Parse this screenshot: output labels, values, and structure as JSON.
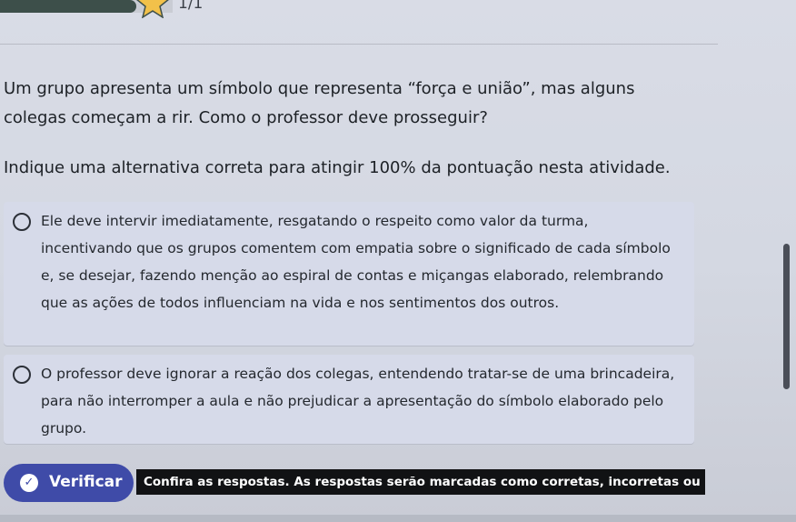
{
  "header": {
    "counter": "1/1"
  },
  "question": {
    "text": "Um grupo apresenta um símbolo que representa “força e união”, mas alguns colegas começam a rir. Como o professor deve prosseguir?",
    "instruction": "Indique uma alternativa correta para atingir 100% da pontuação nesta atividade."
  },
  "options": [
    {
      "text": "Ele deve intervir imediatamente, resgatando o respeito como valor da turma, incentivando que os grupos comentem com empatia sobre o significado de cada símbolo e, se desejar, fazendo menção ao espiral de contas e miçangas elaborado, relembrando que as ações de todos influenciam na vida e nos sentimentos dos outros."
    },
    {
      "text": "O professor deve ignorar a reação dos colegas, entendendo tratar-se de uma brincadeira, para não interromper a aula e não prejudicar a apresentação do símbolo elaborado pelo grupo."
    }
  ],
  "actions": {
    "verify_label": "Verificar",
    "feedback": "Confira as respostas. As respostas serão marcadas como corretas, incorretas ou não respond"
  },
  "icons": {
    "progress_star": "star-icon",
    "verify_check": "check-icon"
  },
  "colors": {
    "accent": "#3f4ba8",
    "progress": "#3d4f4a"
  }
}
